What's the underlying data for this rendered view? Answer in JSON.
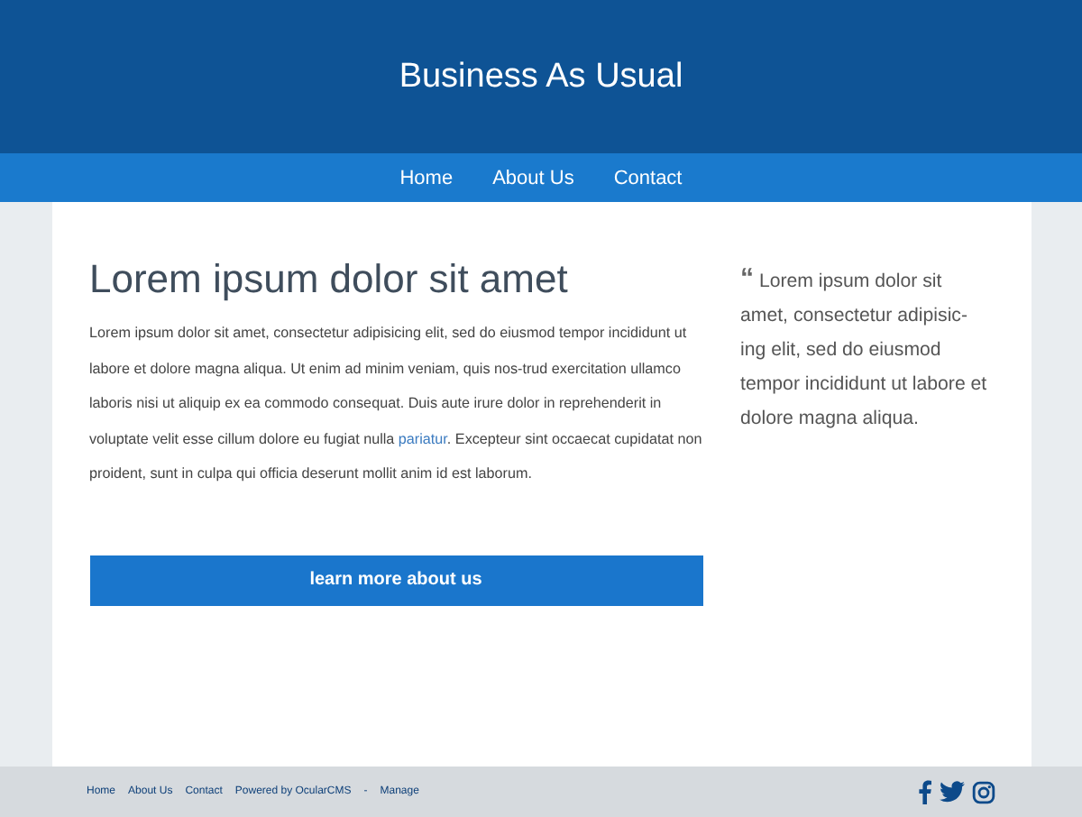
{
  "site_title": "Business As Usual",
  "nav": [
    {
      "label": "Home"
    },
    {
      "label": "About Us"
    },
    {
      "label": "Contact"
    }
  ],
  "main": {
    "heading": "Lorem ipsum dolor sit amet",
    "body_before": "Lorem ipsum dolor sit amet, consectetur adipisicing elit, sed do eiusmod tempor incididunt ut labore et dolore magna aliqua. Ut enim ad minim veniam, quis nos-trud exercitation ullamco laboris nisi ut aliquip ex ea commodo consequat. Duis aute irure dolor in reprehenderit in voluptate velit esse cillum dolore eu fugiat nulla ",
    "body_link": "pariatur",
    "body_after": ". Excepteur sint occaecat cupidatat non proident, sunt in culpa qui officia deserunt mollit anim id est laborum.",
    "button": "learn more about us"
  },
  "quote": {
    "mark": "“",
    "text": "Lorem ipsum dolor sit amet, consectetur adipisic-ing elit, sed do eiusmod tempor incididunt ut labore et dolore magna aliqua."
  },
  "footer": {
    "links": [
      {
        "label": "Home"
      },
      {
        "label": "About Us"
      },
      {
        "label": "Contact"
      },
      {
        "label": "Powered by OcularCMS"
      }
    ],
    "separator": "-",
    "manage": "Manage"
  }
}
